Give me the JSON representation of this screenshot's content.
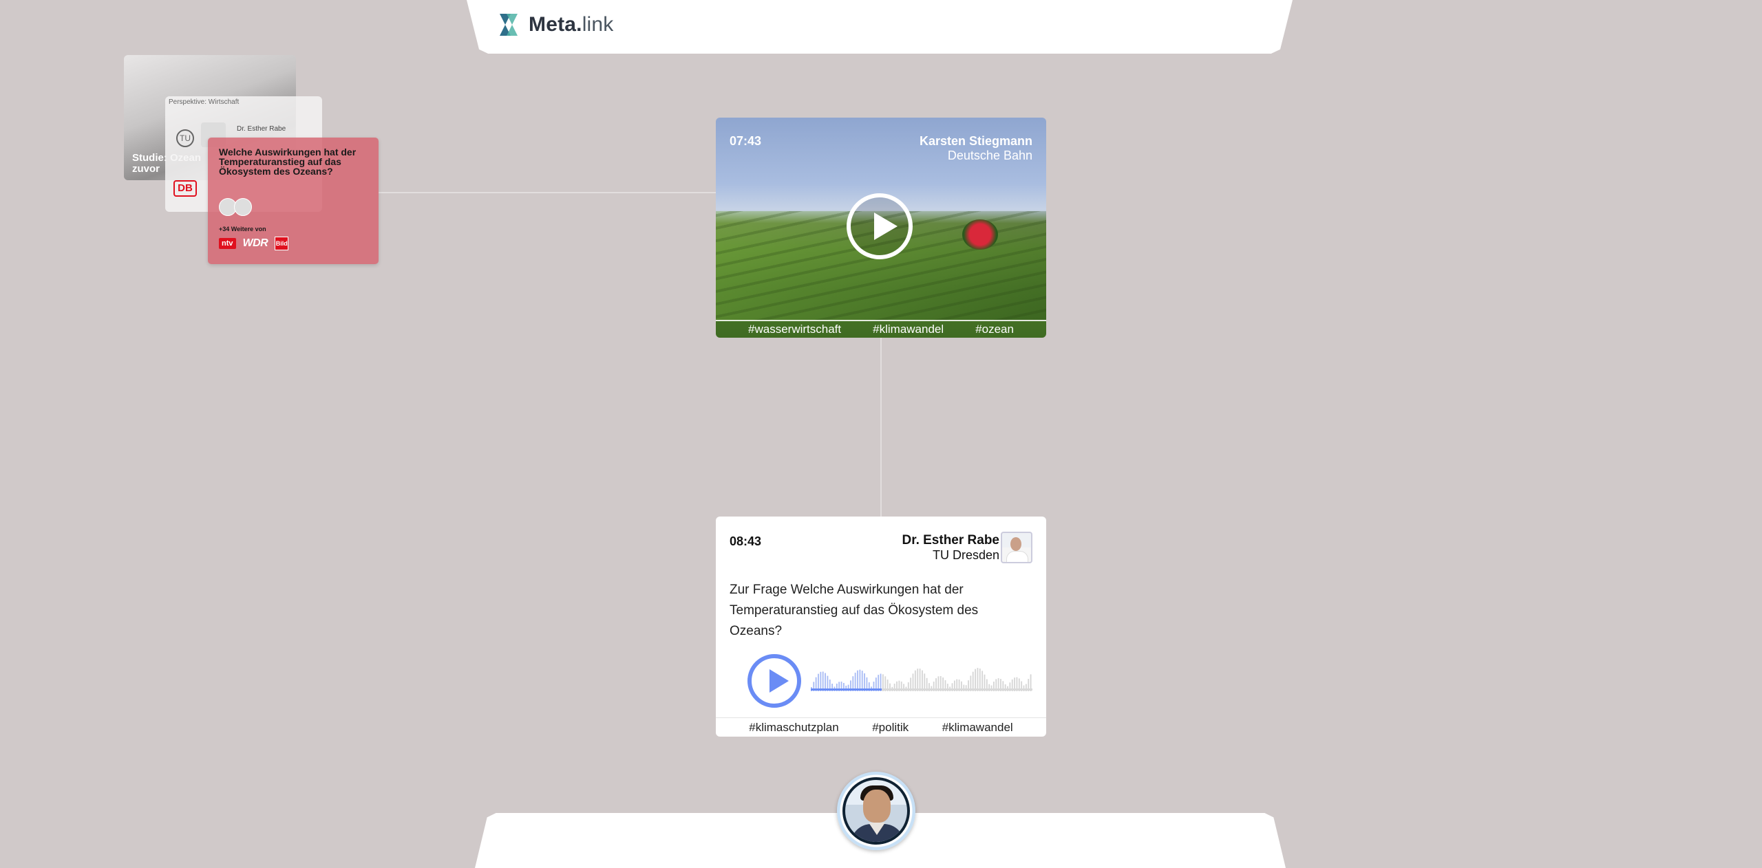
{
  "brand": {
    "bold": "Meta.",
    "light": "link",
    "logo_icon": "meta-link-logo-icon"
  },
  "stack": {
    "back_card_caption": "Studie: Ozean\nzuvor",
    "middle_card_perspective": "Perspektive: Wirtschaft",
    "middle_card_person": "Dr. Esther Rabe",
    "middle_card_logo_tu": "TU",
    "middle_card_logo_db": "DB",
    "front_card_question": "Welche Auswirkungen hat der Temperaturanstieg auf das Ökosystem des Ozeans?",
    "front_card_more": "+34 Weitere von",
    "brands": [
      "ntv",
      "WDR",
      "Bild"
    ]
  },
  "video_card": {
    "time": "07:43",
    "author_name": "Karsten Stiegmann",
    "author_org": "Deutsche Bahn",
    "tags": [
      "#wasserwirtschaft",
      "#klimawandel",
      "#ozean"
    ]
  },
  "audio_card": {
    "time": "08:43",
    "author_name": "Dr. Esther Rabe",
    "author_org": "TU Dresden",
    "question": "Zur Frage Welche Auswirkungen hat der Temperaturanstieg auf das Ökosystem des Ozeans?",
    "progress": 0.32,
    "accent": "#6a8cf5",
    "tags": [
      "#klimaschutzplan",
      "#politik",
      "#klimawandel"
    ]
  },
  "colors": {
    "background": "#d0c9c9",
    "card_highlight": "#d66470"
  }
}
